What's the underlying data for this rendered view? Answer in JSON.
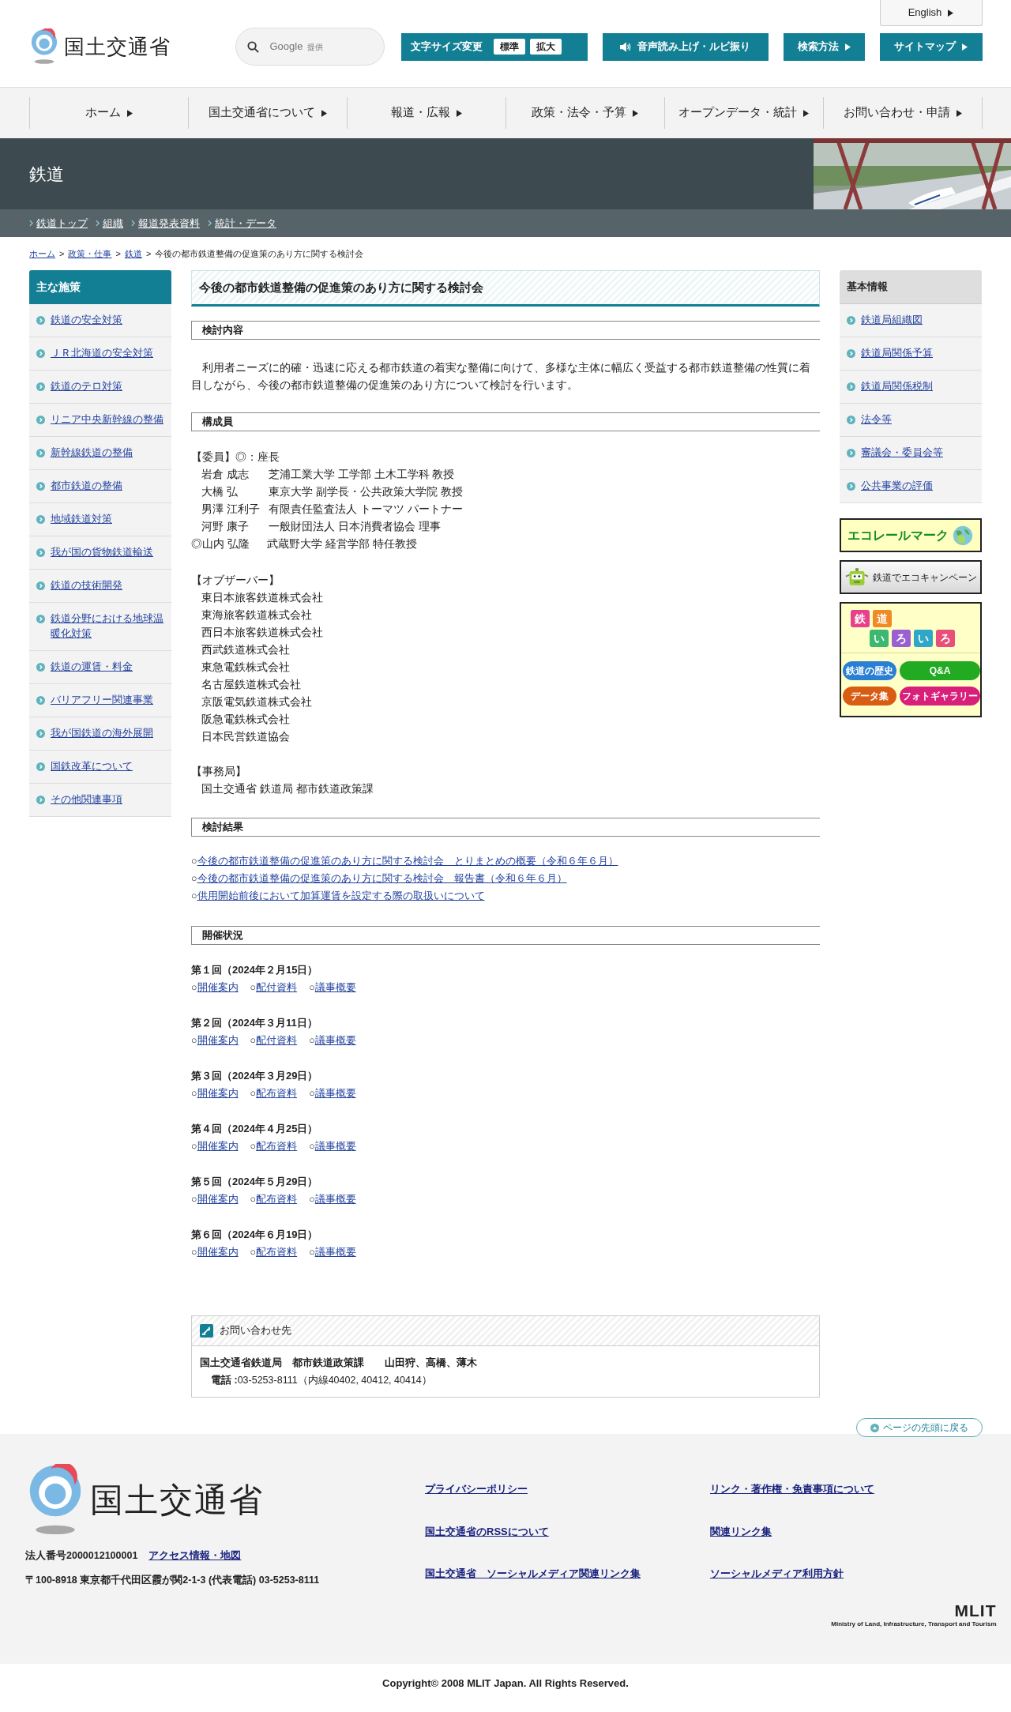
{
  "header": {
    "logo_text": "国土交通省",
    "language_link": "English",
    "search": {
      "brand": "Google",
      "note": "提供"
    },
    "text_size": {
      "label": "文字サイズ変更",
      "options": [
        "標準",
        "拡大"
      ]
    },
    "buttons": [
      {
        "label": "音声読み上げ・ルビ振り",
        "kind": "speaker"
      },
      {
        "label": "検索方法",
        "kind": "arrow"
      },
      {
        "label": "サイトマップ",
        "kind": "arrow"
      }
    ]
  },
  "nav": [
    "ホーム",
    "国土交通省について",
    "報道・広報",
    "政策・法令・予算",
    "オープンデータ・統計",
    "お問い合わせ・申請"
  ],
  "section_title": "鉄道",
  "sub_nav": [
    "鉄道トップ",
    "組織",
    "報道発表資料",
    "統計・データ"
  ],
  "breadcrumb": [
    {
      "kind": "link",
      "label": "ホーム"
    },
    {
      "kind": "separator",
      "label": ">"
    },
    {
      "kind": "link",
      "label": "政策・仕事"
    },
    {
      "kind": "separator",
      "label": ">"
    },
    {
      "kind": "link",
      "label": "鉄道"
    },
    {
      "kind": "separator",
      "label": ">"
    },
    {
      "kind": "current",
      "label": "今後の都市鉄道整備の促進策のあり方に関する検討会"
    }
  ],
  "left_sidebar": {
    "title": "主な施策",
    "items": [
      "鉄道の安全対策",
      "ＪＲ北海道の安全対策",
      "鉄道のテロ対策",
      "リニア中央新幹線の整備",
      "新幹線鉄道の整備",
      "都市鉄道の整備",
      "地域鉄道対策",
      "我が国の貨物鉄道輸送",
      "鉄道の技術開発",
      "鉄道分野における地球温暖化対策",
      "鉄道の運賃・料金",
      "バリアフリー関連事業",
      "我が国鉄道の海外展開",
      "国鉄改革について",
      "その他関連事項"
    ]
  },
  "main": {
    "title": "今後の都市鉄道整備の促進策のあり方に関する検討会",
    "sections": [
      {
        "heading": "検討内容",
        "kind": "paragraph",
        "text": "　利用者ニーズに的確・迅速に応える都市鉄道の着実な整備に向けて、多様な主体に幅広く受益する都市鉄道整備の性質に着目しながら、今後の都市鉄道整備の促進策のあり方について検討を行います。"
      },
      {
        "heading": "構成員",
        "kind": "members",
        "committee": {
          "title": "【委員】◎：座長",
          "members": [
            {
              "name": "岩倉 成志",
              "affiliation": "芝浦工業大学 工学部 土木工学科 教授",
              "chair": false
            },
            {
              "name": "大橋 弘",
              "affiliation": "東京大学 副学長・公共政策大学院 教授",
              "chair": false
            },
            {
              "name": "男澤 江利子",
              "affiliation": "有限責任監査法人 トーマツ パートナー",
              "chair": false
            },
            {
              "name": "河野 康子",
              "affiliation": "一般財団法人 日本消費者協会 理事",
              "chair": false
            },
            {
              "name": "◎山内 弘隆",
              "affiliation": "武蔵野大学 経営学部 特任教授",
              "chair": true
            }
          ]
        },
        "observers": {
          "title": "【オブザーバー】",
          "items": [
            "東日本旅客鉄道株式会社",
            "東海旅客鉄道株式会社",
            "西日本旅客鉄道株式会社",
            "西武鉄道株式会社",
            "東急電鉄株式会社",
            "名古屋鉄道株式会社",
            "京阪電気鉄道株式会社",
            "阪急電鉄株式会社",
            "日本民営鉄道協会"
          ]
        },
        "secretariat": {
          "title": "【事務局】",
          "items": [
            "国土交通省 鉄道局 都市鉄道政策課"
          ]
        }
      },
      {
        "heading": "検討結果",
        "kind": "links",
        "links": [
          {
            "bullet": "○",
            "label": "今後の都市鉄道整備の促進策のあり方に関する検討会　とりまとめの概要（令和６年６月）"
          },
          {
            "bullet": "○",
            "label": "今後の都市鉄道整備の促進策のあり方に関する検討会　報告書（令和６年６月）"
          },
          {
            "bullet": "○",
            "label": "供用開始前後において加算運賃を設定する際の取扱いについて"
          }
        ]
      },
      {
        "heading": "開催状況",
        "kind": "meetings",
        "meetings": [
          {
            "title": "第１回（2024年２月15日）",
            "links": [
              {
                "bullet": "○",
                "label": "開催案内"
              },
              {
                "bullet": "○",
                "label": "配付資料"
              },
              {
                "bullet": "○",
                "label": "議事概要"
              }
            ]
          },
          {
            "title": "第２回（2024年３月11日）",
            "links": [
              {
                "bullet": "○",
                "label": "開催案内"
              },
              {
                "bullet": "○",
                "label": "配付資料"
              },
              {
                "bullet": "○",
                "label": "議事概要"
              }
            ]
          },
          {
            "title": "第３回（2024年３月29日）",
            "links": [
              {
                "bullet": "○",
                "label": "開催案内"
              },
              {
                "bullet": "○",
                "label": "配布資料"
              },
              {
                "bullet": "○",
                "label": "議事概要"
              }
            ]
          },
          {
            "title": "第４回（2024年４月25日）",
            "links": [
              {
                "bullet": "○",
                "label": "開催案内"
              },
              {
                "bullet": "○",
                "label": "配布資料"
              },
              {
                "bullet": "○",
                "label": "議事概要"
              }
            ]
          },
          {
            "title": "第５回（2024年５月29日）",
            "links": [
              {
                "bullet": "○",
                "label": "開催案内"
              },
              {
                "bullet": "○",
                "label": "配布資料"
              },
              {
                "bullet": "○",
                "label": "議事概要"
              }
            ]
          },
          {
            "title": "第６回（2024年６月19日）",
            "links": [
              {
                "bullet": "○",
                "label": "開催案内"
              },
              {
                "bullet": "○",
                "label": "配布資料"
              },
              {
                "bullet": "○",
                "label": "議事概要"
              }
            ]
          }
        ]
      }
    ]
  },
  "contact": {
    "title": "お問い合わせ先",
    "office": "国土交通省鉄道局　都市鉄道政策課　　山田狩、高橋、薄木",
    "phone": "**電話 :**03-5253-8111（内線40402, 40412, 40414）"
  },
  "right_sidebar": {
    "title": "基本情報",
    "items": [
      "鉄道局組織図",
      "鉄道局関係予算",
      "鉄道局関係税制",
      "法令等",
      "審議会・委員会等",
      "公共事業の評価"
    ],
    "banners": [
      {
        "kind": "ecorail",
        "label": "エコレールマーク"
      },
      {
        "kind": "campaign",
        "label": "鉄道でエコキャンペーン"
      },
      {
        "kind": "iroiro",
        "chars": [
          {
            "char": "鉄",
            "color": "#e8408a"
          },
          {
            "char": "道",
            "color": "#f08a24"
          },
          {
            "char": "い",
            "color": "#3cb870"
          },
          {
            "char": "ろ",
            "color": "#9a5fd0"
          },
          {
            "char": "い",
            "color": "#2fa8c8"
          },
          {
            "char": "ろ",
            "color": "#e8507a"
          }
        ],
        "buttons": [
          {
            "label": "鉄道の歴史",
            "color": "#2a7fd4"
          },
          {
            "label": "Q&A",
            "color": "#22aa22"
          },
          {
            "label": "データ集",
            "color": "#d85c14"
          },
          {
            "label": "フォトギャラリー",
            "color": "#d8207a"
          }
        ]
      }
    ]
  },
  "page_top": "ページの先頭に戻る",
  "footer": {
    "logo_text": "国土交通省",
    "corporate_number": "法人番号2000012100001",
    "access_link": "アクセス情報・地図",
    "address": "〒100-8918 東京都千代田区霞が関2-1-3 (代表電話) 03-5253-8111",
    "links": [
      "プライバシーポリシー",
      "リンク・著作権・免責事項について",
      "国土交通省のRSSについて",
      "関連リンク集",
      "国土交通省　ソーシャルメディア関連リンク集",
      "ソーシャルメディア利用方針"
    ],
    "mlit_logo": "MLIT",
    "mlit_caption": "Ministry of Land, Infrastructure, Transport and Tourism",
    "copyright": "Copyright© 2008 MLIT Japan. All Rights Reserved."
  }
}
